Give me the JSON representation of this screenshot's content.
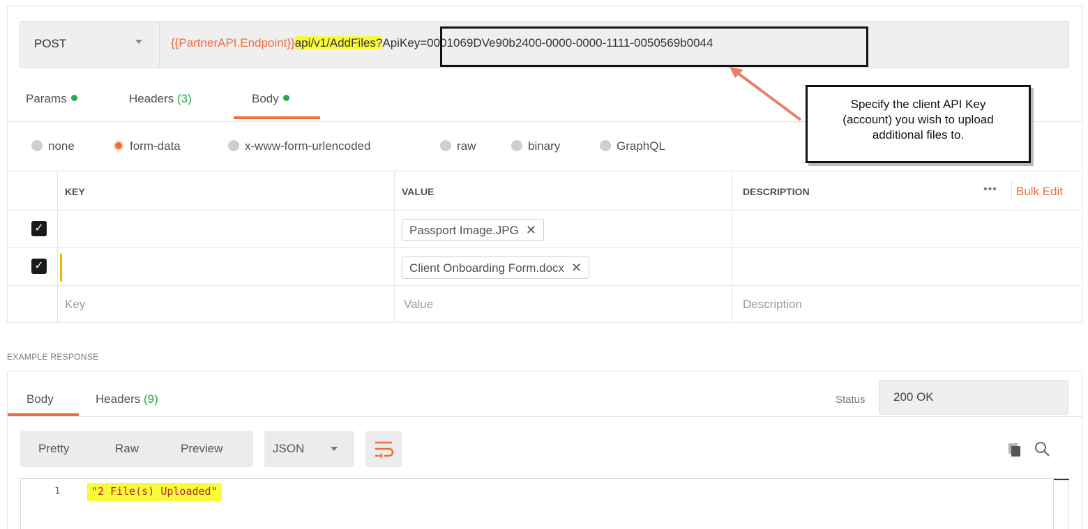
{
  "request": {
    "method": "POST",
    "url_variable": "{{PartnerAPI.Endpoint}}",
    "url_path": "api/v1/AddFiles?",
    "url_query": "ApiKey=0001069DVe90b2400-0000-0000-1111-0050569b0044"
  },
  "request_tabs": [
    {
      "label": "Params",
      "count": "",
      "dot": true
    },
    {
      "label": "Headers",
      "count": "(3)",
      "dot": false
    },
    {
      "label": "Body",
      "count": "",
      "dot": true
    }
  ],
  "body_types": [
    "none",
    "form-data",
    "x-www-form-urlencoded",
    "raw",
    "binary",
    "GraphQL"
  ],
  "body_type_selected": "form-data",
  "table": {
    "headers": {
      "key": "KEY",
      "value": "VALUE",
      "description": "DESCRIPTION"
    },
    "more_label": "•••",
    "bulk_edit": "Bulk Edit",
    "rows": [
      {
        "checked": true,
        "key": "",
        "value": "Passport Image.JPG",
        "description": ""
      },
      {
        "checked": true,
        "key": "",
        "value": "Client Onboarding Form.docx",
        "description": ""
      }
    ],
    "placeholders": {
      "key": "Key",
      "value": "Value",
      "description": "Description"
    }
  },
  "callout": {
    "lines": [
      "Specify the client API Key",
      "(account) you wish to upload",
      "additional files to."
    ]
  },
  "response": {
    "section_label": "EXAMPLE RESPONSE",
    "tabs": [
      {
        "label": "Body",
        "count": ""
      },
      {
        "label": "Headers",
        "count": "(9)"
      }
    ],
    "status_label": "Status",
    "status_value": "200 OK",
    "view_modes": [
      "Pretty",
      "Raw",
      "Preview"
    ],
    "format": "JSON",
    "code_lines": [
      {
        "number": "1",
        "text": "\"2 File(s) Uploaded\""
      }
    ]
  },
  "colors": {
    "accent": "#f26b3a",
    "count_green": "#27a844",
    "highlight": "#fafa3c"
  }
}
